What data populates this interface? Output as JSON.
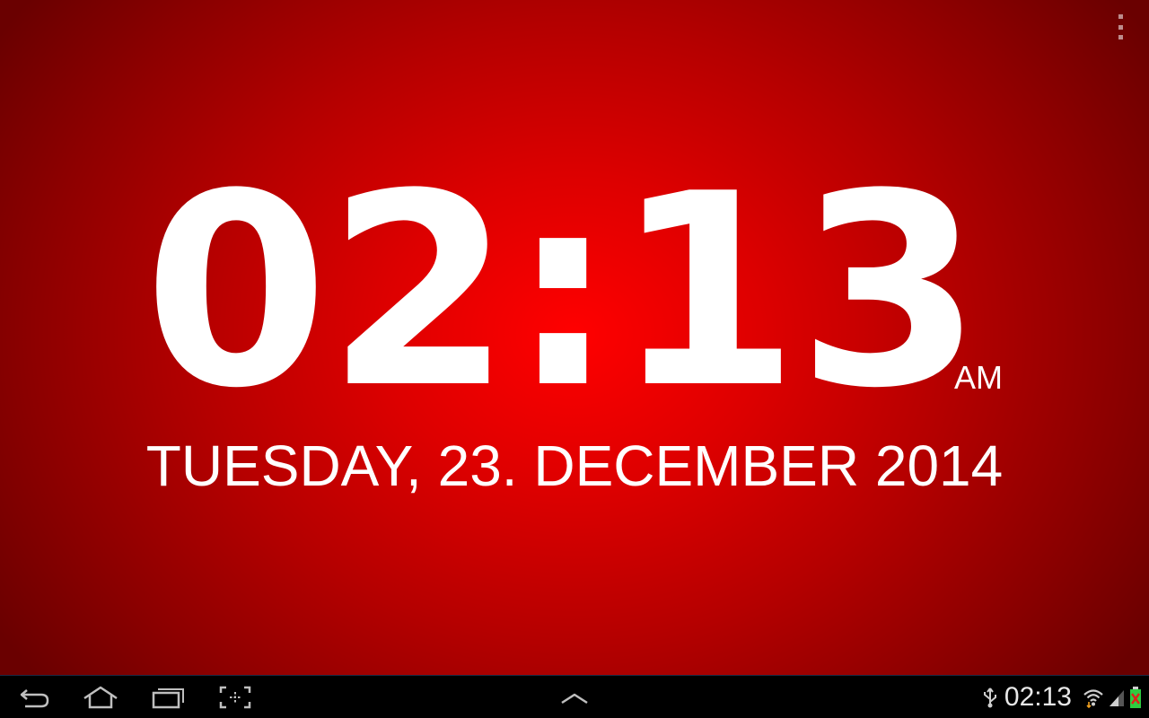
{
  "clock": {
    "time": "02:13",
    "ampm": "AM",
    "date": "TUESDAY, 23. DECEMBER 2014"
  },
  "status_bar": {
    "time": "02:13",
    "icons": [
      "usb-icon",
      "wifi-icon",
      "signal-icon",
      "battery-icon"
    ]
  },
  "nav_bar": {
    "buttons": [
      "back-icon",
      "home-icon",
      "recent-apps-icon",
      "screenshot-icon"
    ],
    "center": "chevron-up-icon"
  },
  "theme": {
    "background_center": "#ff0000",
    "background_edge": "#6a0000",
    "text": "#ffffff",
    "nav_background": "#000000"
  }
}
